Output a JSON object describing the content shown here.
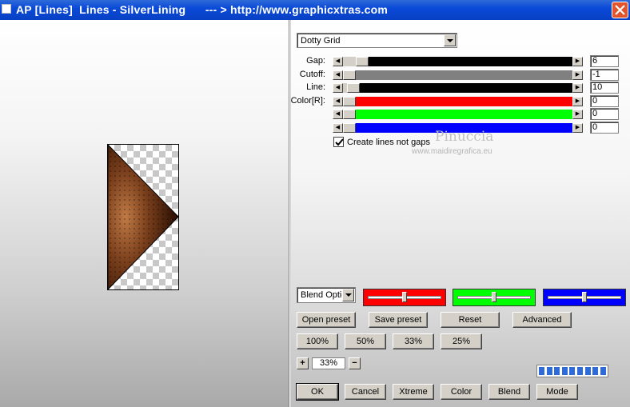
{
  "window": {
    "title": "AP [Lines]  Lines - SilverLining      --- > http://www.graphicxtras.com"
  },
  "preset": {
    "value": "Dotty Grid"
  },
  "sliders": [
    {
      "label": "Gap:",
      "value": "6",
      "fill_color": "#000000",
      "level": 0.06
    },
    {
      "label": "Cutoff:",
      "value": "-1",
      "fill_color": "#808080",
      "level": 0.0
    },
    {
      "label": "Line:",
      "value": "10",
      "fill_color": "#000000",
      "level": 0.02
    },
    {
      "label": "Color[R]:",
      "value": "0",
      "fill_color": "#ff0000",
      "level": 0.0
    },
    {
      "label": "",
      "value": "0",
      "fill_color": "#00ff00",
      "level": 0.0
    },
    {
      "label": "",
      "value": "0",
      "fill_color": "#0000ff",
      "level": 0.0
    }
  ],
  "create_lines_checkbox": {
    "label": "Create lines not gaps",
    "checked": true
  },
  "watermark": {
    "line1": "Pinuccia",
    "line2": "www.maidiregrafica.eu"
  },
  "blend_options": {
    "select_label": "Blend Optio",
    "red": "#ff0000",
    "green": "#00ff00",
    "blue": "#0000ff"
  },
  "buttons": {
    "open_preset": "Open preset",
    "save_preset": "Save preset",
    "reset": "Reset",
    "advanced": "Advanced",
    "zoom100": "100%",
    "zoom50": "50%",
    "zoom33": "33%",
    "zoom25": "25%",
    "zoom_plus": "+",
    "zoom_minus": "−",
    "ok": "OK",
    "cancel": "Cancel",
    "xtreme": "Xtreme",
    "color": "Color",
    "blend": "Blend",
    "mode": "Mode"
  },
  "zoom": {
    "value": "33%"
  },
  "progress": {
    "segments": 9
  },
  "colors": {
    "titlebar": "#0a4ad8",
    "close": "#e1542c",
    "progress": "#2f6bd8"
  }
}
